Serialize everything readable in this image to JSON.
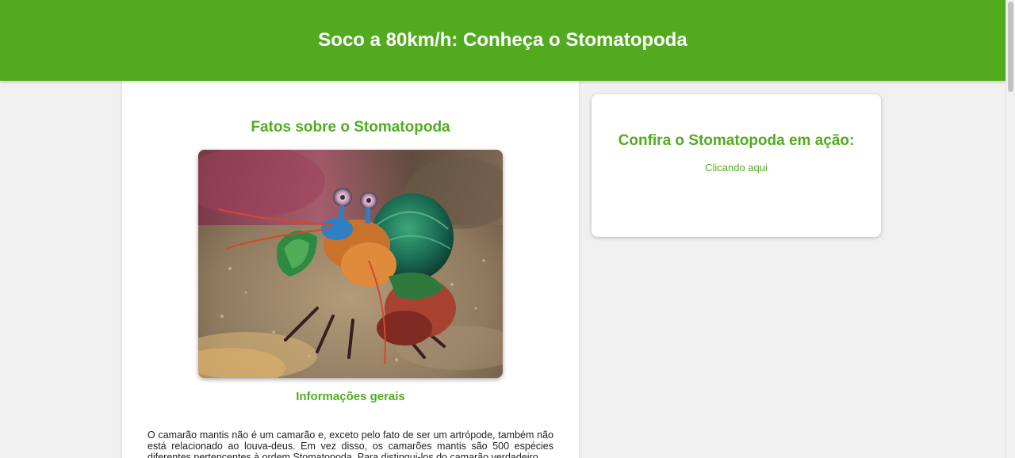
{
  "header": {
    "title": "Soco a 80km/h: Conheça o Stomatopoda"
  },
  "main": {
    "section_title": "Fatos sobre o Stomatopoda",
    "image_alt": "Camarão mantis (Stomatopoda) colorido sobre areia",
    "subsection_title": "Informações gerais",
    "paragraph": "O camarão mantis não é um camarão e, exceto pelo fato de ser um artrópode, também não está relacionado ao louva-deus. Em vez disso, os camarões mantis são 500 espécies diferentes pertencentes à ordem Stomatopoda. Para distingui-los do camarão verdadeiro"
  },
  "aside": {
    "title": "Confira o Stomatopoda em ação:",
    "link_label": "Clicando aqui"
  },
  "colors": {
    "accent": "#52ab1f",
    "background": "#f0f0f0",
    "card": "#ffffff",
    "text": "#222222"
  }
}
